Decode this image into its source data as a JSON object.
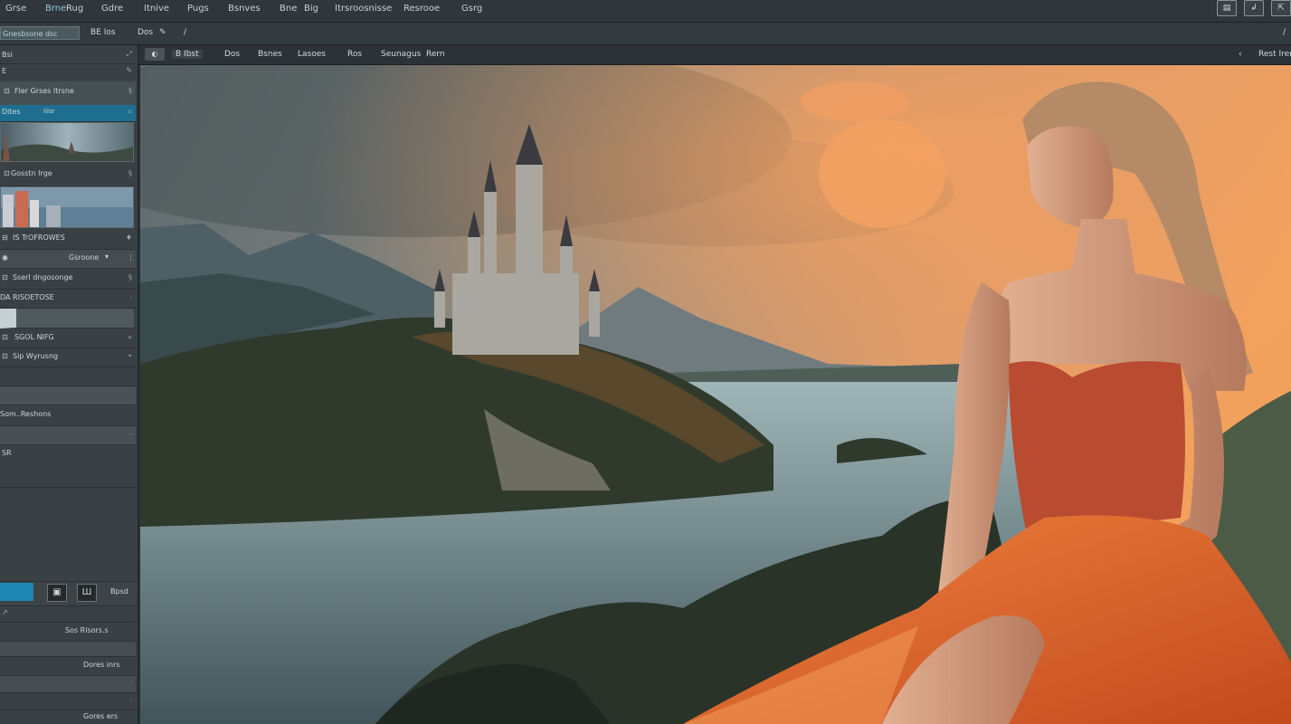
{
  "menubar": {
    "items": [
      "Grse",
      "Brne",
      "Rug",
      "Gdre",
      "Itnive",
      "Pugs",
      "Bsnves",
      "Bne",
      "Big",
      "Itrsroosnisse",
      "Resrooe",
      "Gsrg"
    ]
  },
  "optionsbar": {
    "preset_value": "Gnesbsone dsc",
    "size_label": "BE Ios",
    "mode_label": "Dos"
  },
  "doctabs": {
    "items": [
      "B Ibst",
      "Dos",
      "Bsnes",
      "Lasoes",
      "Ros",
      "Seunagus",
      "Rern"
    ],
    "right_label": "Rest Iren"
  },
  "panel": {
    "rows": [
      "Bsi",
      "E",
      "Fler Grses Itrsne",
      "Dites",
      "Iiisr",
      "Gosstn Irge",
      "IS TrOFROWES",
      "Gsroone",
      "Sserl dngosonge",
      "DA RISOETOSE",
      "SGOL NIFG",
      "Sip Wyrusng",
      "Som..Reshons",
      "SR"
    ],
    "bottom": {
      "label": "Bpsd",
      "rows": [
        "Sos Rlsors.s",
        "Dores inrs",
        "Gores ers"
      ]
    }
  },
  "colors": {
    "accent": "#1e87b4",
    "panel_bg": "#3a4144",
    "menubar_bg": "#30363a"
  }
}
